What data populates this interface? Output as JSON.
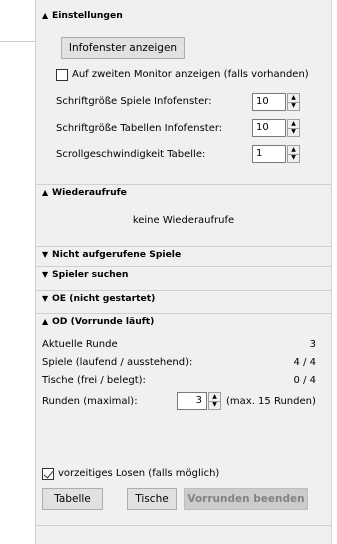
{
  "settings": {
    "header": "Einstellungen",
    "show_button": "Infofenster anzeigen",
    "second_monitor_label": "Auf zweiten Monitor anzeigen (falls vorhanden)",
    "font_games_label": "Schriftgröße Spiele Infofenster:",
    "font_games_value": "10",
    "font_tables_label": "Schriftgröße Tabellen Infofenster:",
    "font_tables_value": "10",
    "scroll_label": "Scrollgeschwindigkeit Tabelle:",
    "scroll_value": "1"
  },
  "recalls": {
    "header": "Wiederaufrufe",
    "empty_text": "keine Wiederaufrufe"
  },
  "collapsed": {
    "not_called": "Nicht aufgerufene Spiele",
    "player_search": "Spieler suchen",
    "oe": "OE (nicht gestartet)"
  },
  "od": {
    "header": "OD (Vorrunde läuft)",
    "current_round_label": "Aktuelle Runde",
    "current_round_value": "3",
    "games_label": "Spiele (laufend / ausstehend):",
    "games_value": "4 / 4",
    "tables_label": "Tische (frei / belegt):",
    "tables_value": "0 / 4",
    "rounds_label": "Runden (maximal):",
    "rounds_value": "3",
    "rounds_suffix": "(max. 15 Runden)",
    "early_draw_label": "vorzeitiges Losen (falls möglich)",
    "btn_table": "Tabelle",
    "btn_tables": "Tische",
    "btn_finish": "Vorrunden beenden"
  }
}
